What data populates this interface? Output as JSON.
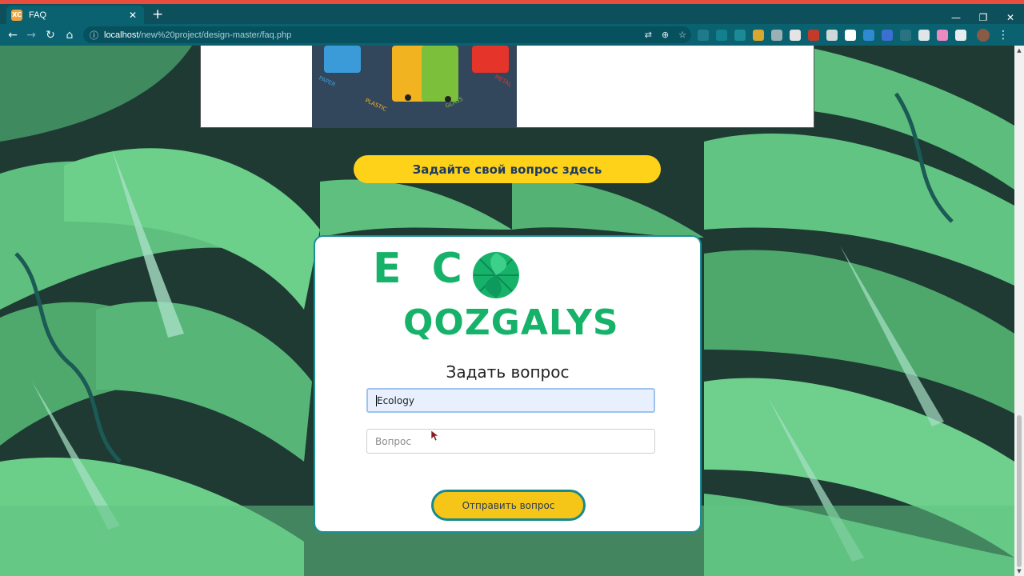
{
  "browser": {
    "tab_title": "FAQ",
    "tab_favicon_text": "XC",
    "url_host": "localhost",
    "url_path": "/new%20project/design-master/faq.php"
  },
  "page": {
    "ask_banner": "Задайте свой вопрос здесь",
    "bins": {
      "labels": [
        "PAPER",
        "PLASTIC",
        "GLASS",
        "METAL"
      ],
      "colors": [
        "#3a9bd8",
        "#f2b320",
        "#7bbf3a",
        "#e5342a"
      ]
    },
    "logo": {
      "line1": "E C",
      "line2": "QOZGALYS",
      "color": "#16b26a"
    },
    "form": {
      "title": "Задать вопрос",
      "topic_value": "Ecology",
      "question_placeholder": "Вопрос",
      "submit_label": "Отправить вопрос"
    }
  },
  "colors": {
    "accent_yellow": "#ffd21a",
    "card_border": "#1a8f98",
    "browser_teal": "#0a6271"
  }
}
